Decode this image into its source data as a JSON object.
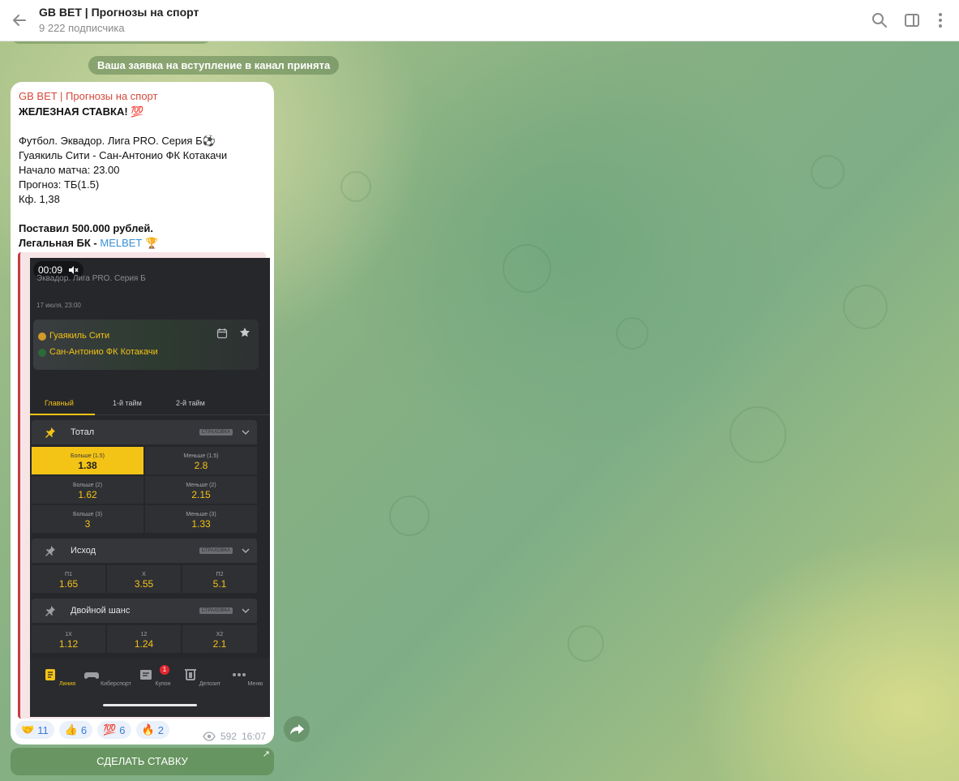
{
  "header": {
    "title": "GB BET | Прогнозы на спорт",
    "subscribers": "9 222 подписчика"
  },
  "service_message": "Ваша заявка на вступление в канал принята",
  "post": {
    "sender": "GB BET | Прогнозы на спорт",
    "lines": [
      "ЖЕЛЕЗНАЯ СТАВКА! 💯",
      "",
      "Футбол. Эквадор. Лига PRO. Серия Б⚽",
      "Гуаякиль Сити - Сан-Антонио ФК Котакачи",
      "Начало матча: 23.00",
      "Прогноз: ТБ(1.5)",
      "Кф. 1,38",
      "",
      "Поставил 500.000 рублей."
    ],
    "legal_prefix": "Легальная БК - ",
    "legal_link": "MELBET",
    "legal_suffix": " 🏆",
    "views": "592",
    "time": "16:07"
  },
  "video": {
    "timer": "00:09",
    "league": "Эквадор. Лига PRO. Серия Б",
    "date": "17 июля, 23:00",
    "team1": "Гуаякиль Сити",
    "team2": "Сан-Антонио ФК Котакачи",
    "tabs": [
      "Главный",
      "1-й тайм",
      "2-й тайм"
    ],
    "badge": "СТРАХОВКА",
    "total": {
      "title": "Тотал",
      "odds": [
        {
          "label": "Больше (1.5)",
          "value": "1.38"
        },
        {
          "label": "Меньше (1.5)",
          "value": "2.8"
        },
        {
          "label": "Больше (2)",
          "value": "1.62"
        },
        {
          "label": "Меньше (2)",
          "value": "2.15"
        },
        {
          "label": "Больше (3)",
          "value": "3"
        },
        {
          "label": "Меньше (3)",
          "value": "1.33"
        }
      ]
    },
    "outcome": {
      "title": "Исход",
      "odds": [
        {
          "label": "П1",
          "value": "1.65"
        },
        {
          "label": "X",
          "value": "3.55"
        },
        {
          "label": "П2",
          "value": "5.1"
        }
      ]
    },
    "double": {
      "title": "Двойной шанс",
      "odds": [
        {
          "label": "1X",
          "value": "1.12"
        },
        {
          "label": "12",
          "value": "1.24"
        },
        {
          "label": "X2",
          "value": "2.1"
        }
      ]
    },
    "nav": [
      "Линия",
      "Киберспорт",
      "Купон",
      "Депозит",
      "Меню"
    ],
    "coupon_count": "1",
    "accent": "#f3c316"
  },
  "reactions": [
    {
      "emoji": "🤝",
      "count": "11"
    },
    {
      "emoji": "👍",
      "count": "6"
    },
    {
      "emoji": "💯",
      "count": "6"
    },
    {
      "emoji": "🔥",
      "count": "2"
    }
  ],
  "bet_button": "СДЕЛАТЬ СТАВКУ"
}
